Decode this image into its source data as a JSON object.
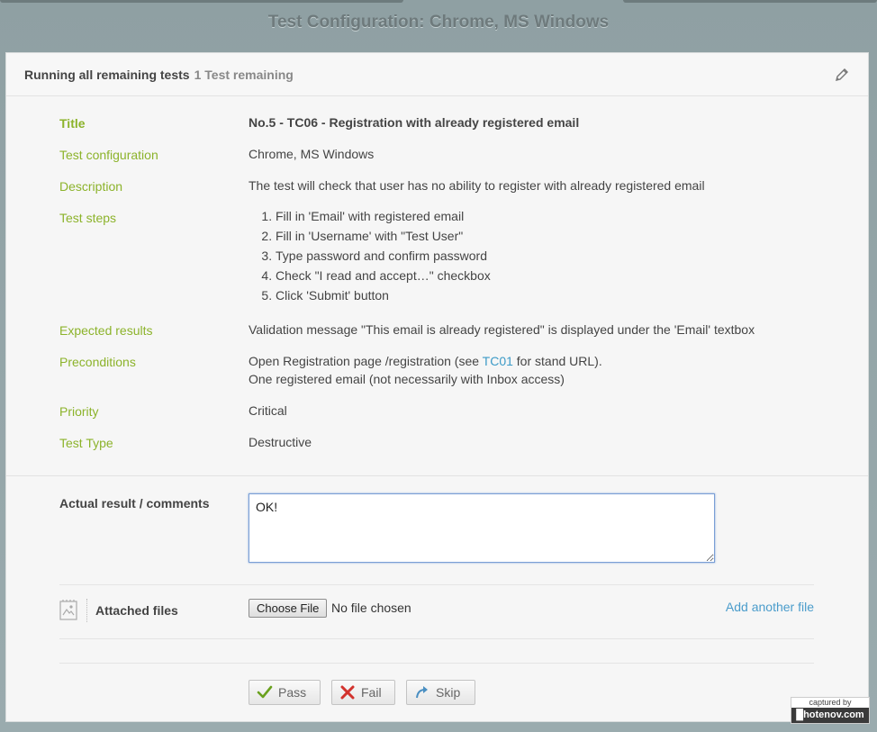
{
  "page": {
    "title": "Test Configuration: Chrome, MS Windows"
  },
  "header": {
    "running": "Running all remaining tests",
    "remaining": "1 Test remaining",
    "edit_icon": "pencil-icon"
  },
  "details": [
    {
      "key": "title",
      "label": "Title",
      "value": "No.5 - TC06 - Registration with already registered email"
    },
    {
      "key": "config",
      "label": "Test configuration",
      "value": "Chrome, MS Windows"
    },
    {
      "key": "description",
      "label": "Description",
      "value": "The test will check that user has no ability to register with already registered email"
    },
    {
      "key": "steps",
      "label": "Test steps",
      "items": [
        "Fill in 'Email' with registered email",
        "Fill in 'Username' with \"Test User\"",
        "Type password and confirm password",
        "Check \"I read and accept…\" checkbox",
        "Click 'Submit' button"
      ]
    },
    {
      "key": "expected",
      "label": "Expected results",
      "value": "Validation message \"This email is already registered\" is displayed under the 'Email' textbox"
    },
    {
      "key": "preconditions",
      "label": "Preconditions",
      "line1_before": "Open Registration page /registration (see ",
      "line1_link": "TC01",
      "line1_after": " for stand URL).",
      "line2": "One registered email (not necessarily with Inbox access)"
    },
    {
      "key": "priority",
      "label": "Priority",
      "value": "Critical"
    },
    {
      "key": "type",
      "label": "Test Type",
      "value": "Destructive"
    }
  ],
  "comments": {
    "label": "Actual result / comments",
    "value": "OK!"
  },
  "attachments": {
    "label": "Attached files",
    "choose_label": "Choose File",
    "status": "No file chosen",
    "add_label": "Add another file",
    "icon": "attachment-icon"
  },
  "actions": {
    "pass": "Pass",
    "fail": "Fail",
    "skip": "Skip"
  },
  "watermark": {
    "top": "captured by",
    "bottom": "█hotenov.com"
  },
  "colors": {
    "label_green": "#8cb32b",
    "link_blue": "#3d9bc7",
    "background": "#9aabae"
  }
}
